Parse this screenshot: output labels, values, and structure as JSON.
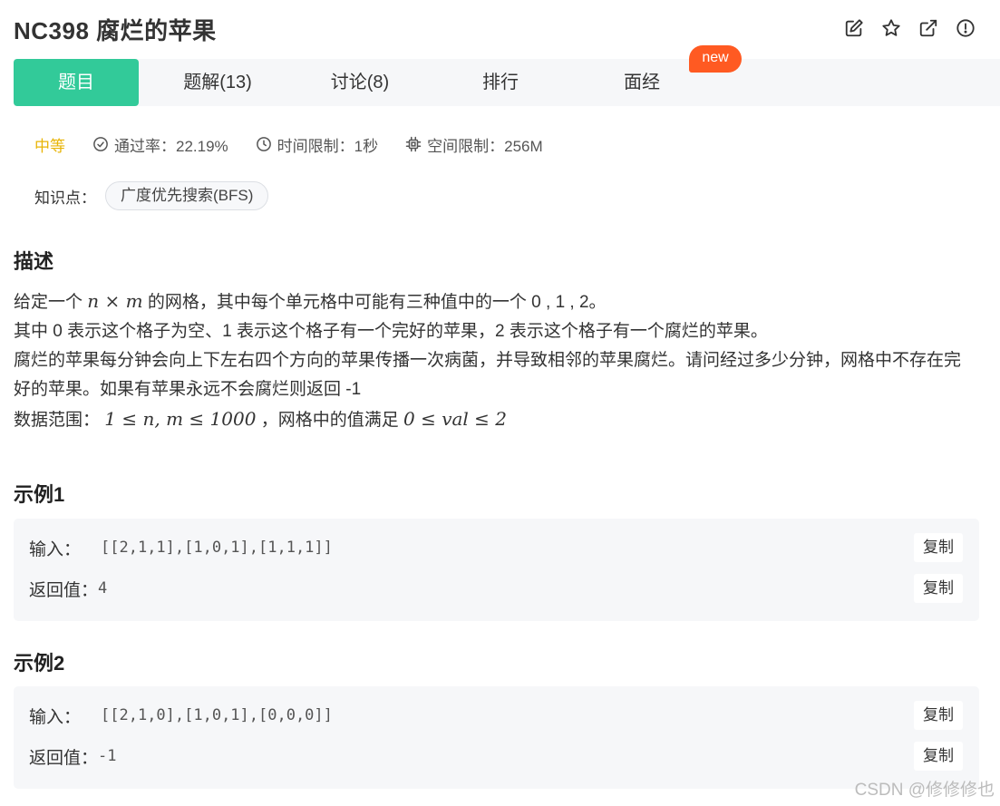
{
  "header": {
    "title": "NC398  腐烂的苹果",
    "actions": [
      "edit-icon",
      "star-icon",
      "external-link-icon",
      "info-icon"
    ]
  },
  "tabs": [
    {
      "label": "题目",
      "active": true
    },
    {
      "label": "题解(13)",
      "active": false
    },
    {
      "label": "讨论(8)",
      "active": false
    },
    {
      "label": "排行",
      "active": false
    },
    {
      "label": "面经",
      "active": false
    }
  ],
  "new_badge": "new",
  "meta": {
    "difficulty": "中等",
    "pass_rate": "通过率：22.19%",
    "time_limit": "时间限制：1秒",
    "space_limit": "空间限制：256M"
  },
  "knowledge": {
    "label": "知识点：",
    "tag": "广度优先搜索(BFS)"
  },
  "description": {
    "title": "描述",
    "line1_pre": "给定一个 ",
    "line1_math_n": "n",
    "line1_math_times": " × ",
    "line1_math_m": "m",
    "line1_post": "  的网格，其中每个单元格中可能有三种值中的一个 0 , 1 , 2。",
    "line2": "其中 0 表示这个格子为空、1 表示这个格子有一个完好的苹果，2 表示这个格子有一个腐烂的苹果。",
    "line3": "腐烂的苹果每分钟会向上下左右四个方向的苹果传播一次病菌，并导致相邻的苹果腐烂。请问经过多少分钟，网格中不存在完好的苹果。如果有苹果永远不会腐烂则返回 -1",
    "range_label": "数据范围：",
    "range_math1": "1 ≤ n, m ≤ 1000",
    "range_mid": "，网格中的值满足 ",
    "range_math2": "0 ≤ val ≤ 2"
  },
  "examples": [
    {
      "title": "示例1",
      "input_label": "输入：",
      "input": "[[2,1,1],[1,0,1],[1,1,1]]",
      "output_label": "返回值：",
      "output": "4",
      "copy_label": "复制"
    },
    {
      "title": "示例2",
      "input_label": "输入：",
      "input": "[[2,1,0],[1,0,1],[0,0,0]]",
      "output_label": "返回值：",
      "output": "-1",
      "copy_label": "复制"
    }
  ],
  "watermark": "CSDN @修修修也",
  "colors": {
    "accent": "#32ca99",
    "difficulty": "#e8b406",
    "new_badge": "#ff5a22",
    "tab_bg": "#f6f7f9"
  }
}
